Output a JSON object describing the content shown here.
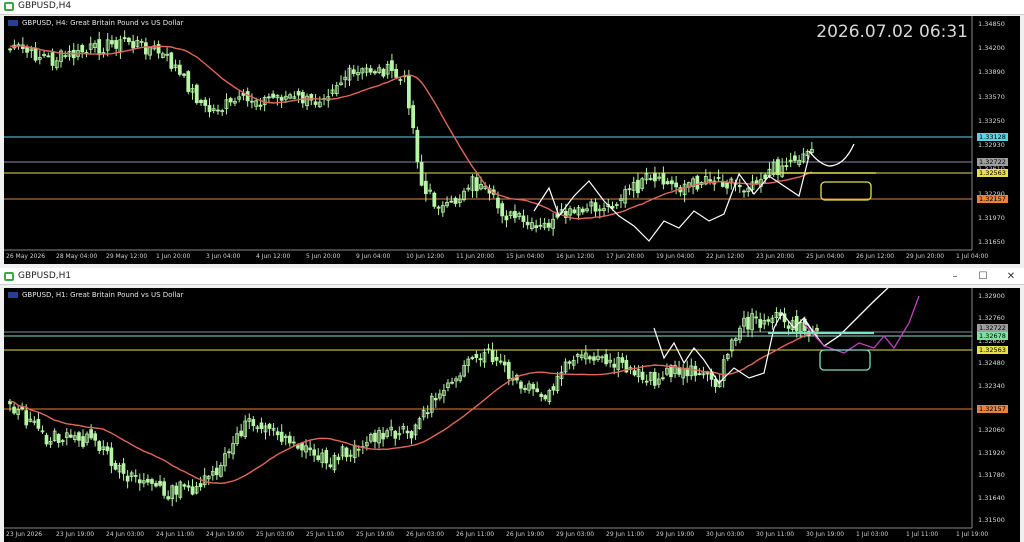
{
  "top_window": {
    "title": "GBPUSD,H4",
    "chart_label": "GBPUSD, H4:  Great Britain Pound vs US Dollar",
    "clock": "2026.07.02 06:31",
    "price_labels": [
      "1.34850",
      "1.34200",
      "1.33890",
      "1.33570",
      "1.33250",
      "1.32930",
      "1.32610",
      "1.32290",
      "1.31970",
      "1.31650"
    ],
    "badges": [
      {
        "text": "1.33128",
        "color": "#5fd3e6"
      },
      {
        "text": "1.32722",
        "color": "#9e9e9e"
      },
      {
        "text": "1.32563",
        "color": "#e6e04a"
      },
      {
        "text": "1.32157",
        "color": "#e8823c"
      }
    ],
    "time_labels": [
      "26 May 2026",
      "28 May 04:00",
      "29 May 12:00",
      "1 Jun 20:00",
      "3 Jun 04:00",
      "4 Jun 12:00",
      "5 Jun 20:00",
      "9 Jun 04:00",
      "10 Jun 12:00",
      "11 Jun 20:00",
      "15 Jun 04:00",
      "16 Jun 12:00",
      "17 Jun 20:00",
      "19 Jun 04:00",
      "22 Jun 12:00",
      "23 Jun 20:00",
      "25 Jun 04:00",
      "26 Jun 12:00",
      "29 Jun 20:00",
      "1 Jul 04:00"
    ]
  },
  "bottom_window": {
    "title": "GBPUSD,H1",
    "chart_label": "GBPUSD, H1:  Great Britain Pound vs US Dollar",
    "price_labels": [
      "1.32900",
      "1.32760",
      "1.32620",
      "1.32480",
      "1.32340",
      "1.32200",
      "1.32060",
      "1.31920",
      "1.31780",
      "1.31640",
      "1.31500"
    ],
    "badges": [
      {
        "text": "1.32722",
        "color": "#9e9e9e"
      },
      {
        "text": "1.32678",
        "color": "#7fe0a0"
      },
      {
        "text": "1.32563",
        "color": "#e6e04a"
      },
      {
        "text": "1.32157",
        "color": "#e8823c"
      }
    ],
    "time_labels": [
      "23 Jun 2026",
      "23 Jun 19:00",
      "24 Jun 03:00",
      "24 Jun 11:00",
      "24 Jun 19:00",
      "25 Jun 03:00",
      "25 Jun 11:00",
      "25 Jun 19:00",
      "26 Jun 03:00",
      "26 Jun 11:00",
      "26 Jun 19:00",
      "29 Jun 03:00",
      "29 Jun 11:00",
      "29 Jun 19:00",
      "30 Jun 03:00",
      "30 Jun 11:00",
      "30 Jun 19:00",
      "1 Jul 03:00",
      "1 Jul 11:00",
      "1 Jul 19:00"
    ]
  },
  "buttons": {
    "minimize": "–",
    "maximize": "☐",
    "close": "✕"
  },
  "colors": {
    "bull": "#b7f5a6",
    "bear": "#b7f5a6",
    "ma": "#e0675a",
    "cyan": "#5fd3e6",
    "yellow": "#e6e04a",
    "orange": "#e8823c",
    "magenta": "#c040c0",
    "mint": "#7fe0c0"
  }
}
